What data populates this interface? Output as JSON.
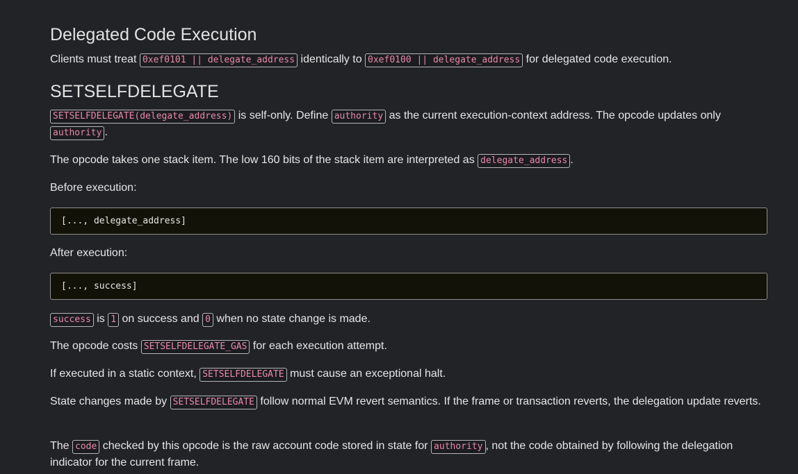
{
  "section1": {
    "heading": "Delegated Code Execution",
    "p1": {
      "t1": "Clients must treat ",
      "c1": "0xef0101 || delegate_address",
      "t2": " identically to ",
      "c2": "0xef0100 || delegate_address",
      "t3": " for delegated code execution."
    }
  },
  "section2": {
    "heading": "SETSELFDELEGATE",
    "p1": {
      "c1": "SETSELFDELEGATE(delegate_address)",
      "t1": " is self-only. Define ",
      "c2": "authority",
      "t2": " as the current execution-context address. The opcode updates only ",
      "c3": "authority",
      "t3": "."
    },
    "p2": {
      "t1": "The opcode takes one stack item. The low 160 bits of the stack item are interpreted as ",
      "c1": "delegate_address",
      "t2": "."
    },
    "before_label": "Before execution:",
    "before_code": "[..., delegate_address]",
    "after_label": "After execution:",
    "after_code": "[..., success]",
    "p3": {
      "c1": "success",
      "t1": " is ",
      "c2": "1",
      "t2": " on success and ",
      "c3": "0",
      "t3": " when no state change is made."
    },
    "p4": {
      "t1": "The opcode costs ",
      "c1": "SETSELFDELEGATE_GAS",
      "t2": " for each execution attempt."
    },
    "p5": {
      "t1": "If executed in a static context, ",
      "c1": "SETSELFDELEGATE",
      "t2": " must cause an exceptional halt."
    },
    "p6": {
      "t1": "State changes made by ",
      "c1": "SETSELFDELEGATE",
      "t2": " follow normal EVM revert semantics. If the frame or transaction reverts, the delegation update reverts."
    },
    "p7": {
      "t1": "The ",
      "c1": "code",
      "t2": " checked by this opcode is the raw account code stored in state for ",
      "c2": "authority",
      "t3": ", not the code obtained by following the delegation indicator for the current frame."
    }
  }
}
